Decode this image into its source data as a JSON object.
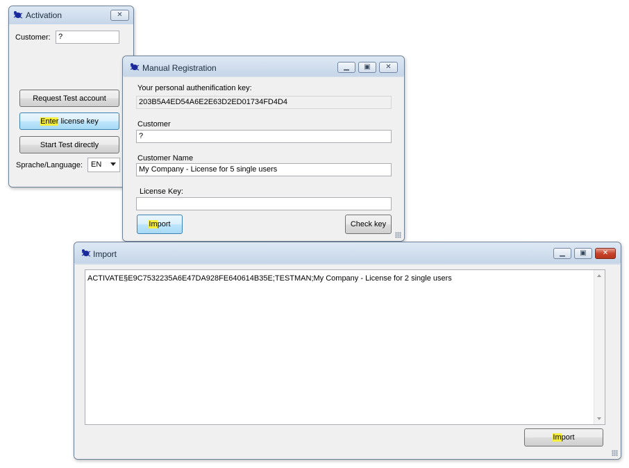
{
  "activation": {
    "title": "Activation",
    "customer_label": "Customer:",
    "customer_value": "?",
    "request_test_label": "Request Test account",
    "enter_key_highlight": "Enter",
    "enter_key_rest": " license key",
    "start_test_label": "Start Test directly",
    "language_label": "Sprache/Language:",
    "language_value": "EN"
  },
  "manual": {
    "title": "Manual Registration",
    "auth_key_label": "Your personal authenification key:",
    "auth_key_value": "203B5A4ED54A6E2E63D2ED01734FD4D4",
    "customer_label": "Customer",
    "customer_value": "?",
    "customer_name_label": "Customer Name",
    "customer_name_value": "My Company - License for 5 single users",
    "license_key_label": "License Key:",
    "license_key_value": "",
    "import_highlight": "Im",
    "import_rest": "port",
    "check_key_label": "Check key"
  },
  "import": {
    "title": "Import",
    "text_value": "ACTIVATE§E9C7532235A6E47DA928FE640614B35E;TESTMAN;My Company - License for 2 single users",
    "import_highlight": "Im",
    "import_rest": "port"
  },
  "icons": {
    "app": "bug-app-icon",
    "minimize": "minimize-icon",
    "maximize": "maximize-icon",
    "close": "close-icon"
  }
}
